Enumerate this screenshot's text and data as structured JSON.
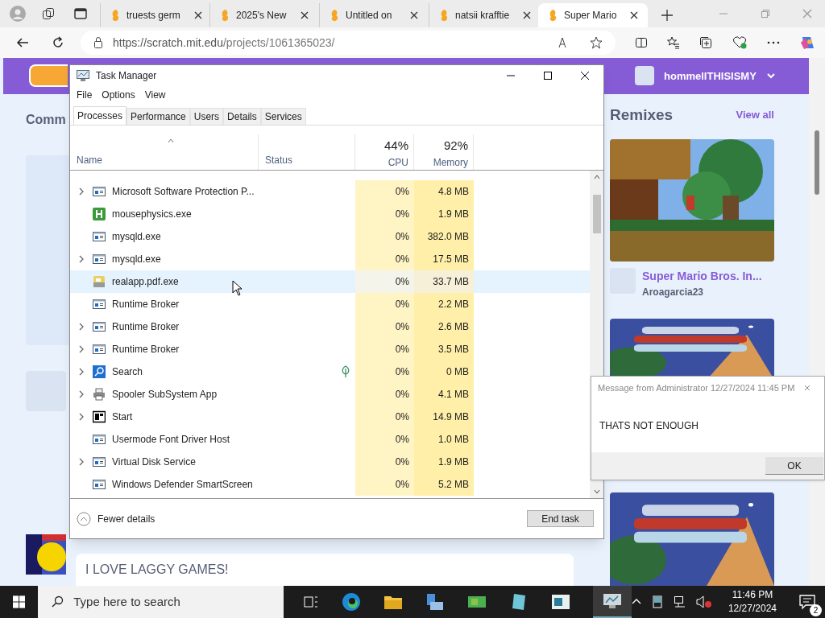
{
  "browser": {
    "tabs": [
      {
        "title": "truests germ",
        "selected": false
      },
      {
        "title": "2025's New",
        "selected": false
      },
      {
        "title": "Untitled on",
        "selected": false
      },
      {
        "title": "natsii krafftie",
        "selected": false
      },
      {
        "title": "Super Mario",
        "selected": true
      }
    ],
    "url_host": "https://scratch.mit.edu",
    "url_path": "/projects/1061365023/"
  },
  "page": {
    "username": "hommellTHISISMY",
    "left_heading": "Comm",
    "comment": "I LOVE LAGGY GAMES!",
    "remixes_title": "Remixes",
    "view_all": "View all",
    "remix": {
      "title": "Super Mario Bros. In...",
      "author": "Aroagarcia23"
    }
  },
  "task_manager": {
    "title": "Task Manager",
    "menu": [
      "File",
      "Options",
      "View"
    ],
    "tabs": [
      {
        "label": "Processes",
        "selected": true
      },
      {
        "label": "Performance",
        "selected": false
      },
      {
        "label": "Users",
        "selected": false
      },
      {
        "label": "Details",
        "selected": false
      },
      {
        "label": "Services",
        "selected": false
      }
    ],
    "columns": {
      "name": "Name",
      "status": "Status",
      "cpu_total": "44%",
      "cpu": "CPU",
      "memory_total": "92%",
      "memory": "Memory"
    },
    "rows": [
      {
        "name": "Microsoft Software Protection P...",
        "cpu": "0%",
        "memory": "4.8 MB",
        "expandable": true,
        "kind": "window",
        "selected": false,
        "efficiency": false
      },
      {
        "name": "mousephysics.exe",
        "cpu": "0%",
        "memory": "1.9 MB",
        "expandable": false,
        "kind": "h",
        "selected": false,
        "efficiency": false
      },
      {
        "name": "mysqld.exe",
        "cpu": "0%",
        "memory": "382.0 MB",
        "expandable": false,
        "kind": "window",
        "selected": false,
        "efficiency": false
      },
      {
        "name": "mysqld.exe",
        "cpu": "0%",
        "memory": "17.5 MB",
        "expandable": true,
        "kind": "window",
        "selected": false,
        "efficiency": false
      },
      {
        "name": "realapp.pdf.exe",
        "cpu": "0%",
        "memory": "33.7 MB",
        "expandable": false,
        "kind": "document",
        "selected": true,
        "efficiency": false
      },
      {
        "name": "Runtime Broker",
        "cpu": "0%",
        "memory": "2.2 MB",
        "expandable": false,
        "kind": "window",
        "selected": false,
        "efficiency": false
      },
      {
        "name": "Runtime Broker",
        "cpu": "0%",
        "memory": "2.6 MB",
        "expandable": true,
        "kind": "window",
        "selected": false,
        "efficiency": false
      },
      {
        "name": "Runtime Broker",
        "cpu": "0%",
        "memory": "3.5 MB",
        "expandable": true,
        "kind": "window",
        "selected": false,
        "efficiency": false
      },
      {
        "name": "Search",
        "cpu": "0%",
        "memory": "0 MB",
        "expandable": true,
        "kind": "search",
        "selected": false,
        "efficiency": true
      },
      {
        "name": "Spooler SubSystem App",
        "cpu": "0%",
        "memory": "4.1 MB",
        "expandable": true,
        "kind": "printer",
        "selected": false,
        "efficiency": false
      },
      {
        "name": "Start",
        "cpu": "0%",
        "memory": "14.9 MB",
        "expandable": true,
        "kind": "start",
        "selected": false,
        "efficiency": false
      },
      {
        "name": "Usermode Font Driver Host",
        "cpu": "0%",
        "memory": "1.0 MB",
        "expandable": false,
        "kind": "window",
        "selected": false,
        "efficiency": false
      },
      {
        "name": "Virtual Disk Service",
        "cpu": "0%",
        "memory": "1.9 MB",
        "expandable": true,
        "kind": "window",
        "selected": false,
        "efficiency": false
      },
      {
        "name": "Windows Defender SmartScreen",
        "cpu": "0%",
        "memory": "5.2 MB",
        "expandable": false,
        "kind": "window",
        "selected": false,
        "efficiency": false
      }
    ],
    "fewer_details": "Fewer details",
    "end_task": "End task"
  },
  "message": {
    "title": "Message from Administrator 12/27/2024 11:45 PM",
    "body": "THATS NOT ENOUGH",
    "ok": "OK"
  },
  "taskbar": {
    "search_placeholder": "Type here to search",
    "time": "11:46 PM",
    "date": "12/27/2024",
    "notifications": "2"
  }
}
